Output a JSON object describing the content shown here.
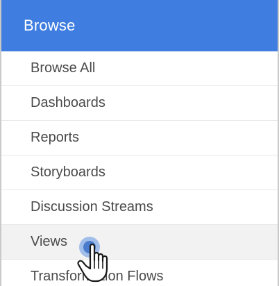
{
  "header": {
    "title": "Browse"
  },
  "menu": {
    "items": [
      {
        "label": "Browse All"
      },
      {
        "label": "Dashboards"
      },
      {
        "label": "Reports"
      },
      {
        "label": "Storyboards"
      },
      {
        "label": "Discussion Streams"
      },
      {
        "label": "Views",
        "hovered": true
      },
      {
        "label": "Transformation Flows"
      }
    ]
  },
  "cursor": {
    "icon": "pointer-hand-icon",
    "indicator": "click-ripple-icon"
  },
  "colors": {
    "header_bg": "#3f7ee0",
    "header_text": "#ffffff",
    "item_text": "#4a4a4a",
    "hover_bg": "#f2f2f2"
  }
}
